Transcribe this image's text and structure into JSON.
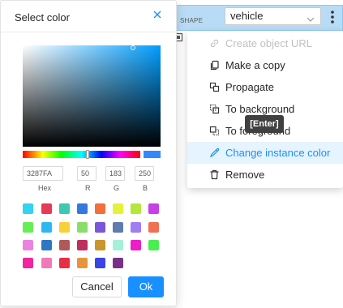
{
  "object_item": {
    "shape_label": "SHAPE",
    "label_value": "vehicle"
  },
  "context_menu": {
    "items": [
      {
        "label": "Create object URL",
        "icon": "link-icon",
        "state": "disabled"
      },
      {
        "label": "Make a copy",
        "icon": "copy-icon",
        "state": "normal"
      },
      {
        "label": "Propagate",
        "icon": "propagate-icon",
        "state": "normal"
      },
      {
        "label": "To background",
        "icon": "to-background-icon",
        "state": "normal"
      },
      {
        "label": "To foreground",
        "icon": "to-foreground-icon",
        "state": "normal"
      },
      {
        "label": "Change instance color",
        "icon": "color-picker-icon",
        "state": "active"
      },
      {
        "label": "Remove",
        "icon": "trash-icon",
        "state": "normal"
      }
    ],
    "tooltip": "[Enter]"
  },
  "color_picker": {
    "title": "Select color",
    "current_color": "#3287FA",
    "hex": "3287FA",
    "r": "50",
    "g": "183",
    "b": "250",
    "labels": {
      "hex": "Hex",
      "r": "R",
      "g": "G",
      "b": "B"
    },
    "swatches": [
      "#33d4f0",
      "#e83a55",
      "#3ec7b1",
      "#3479e0",
      "#f0703e",
      "#e4f23a",
      "#b3e83a",
      "#c740e6",
      "#67ee57",
      "#2fb8f0",
      "#f5d13a",
      "#8cdc6b",
      "#7a57d9",
      "#5f7cb0",
      "#9f7df2",
      "#f07050",
      "#ea82e0",
      "#2f76c4",
      "#b0585c",
      "#bd305d",
      "#c9952e",
      "#a5f0d9",
      "#ee1cc9",
      "#47ef50",
      "#f3249f",
      "#f07ab8",
      "#e82e44",
      "#e8943a",
      "#3b44e4",
      "#7b3088"
    ],
    "cancel_label": "Cancel",
    "ok_label": "Ok"
  }
}
